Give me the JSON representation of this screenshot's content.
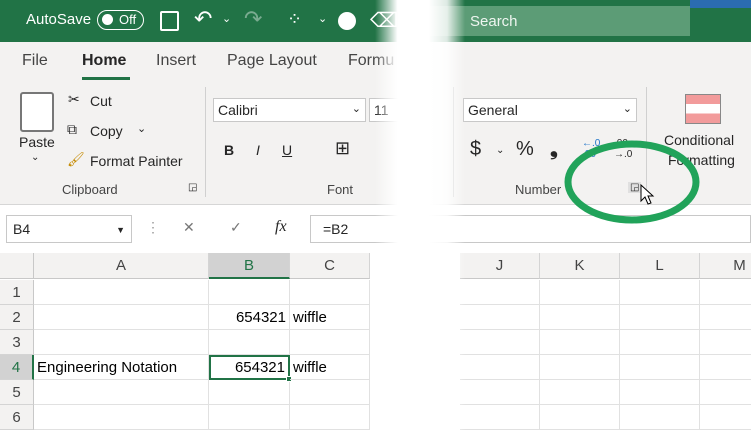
{
  "titlebar": {
    "autosave_label": "AutoSave",
    "toggle_state": "Off",
    "search_placeholder": "Search"
  },
  "tabs": [
    "File",
    "Home",
    "Insert",
    "Page Layout",
    "Formu"
  ],
  "ribbon": {
    "clipboard": {
      "paste": "Paste",
      "cut": "Cut",
      "copy": "Copy",
      "format_painter": "Format Painter",
      "label": "Clipboard"
    },
    "font": {
      "name": "Calibri",
      "size": "11",
      "bold": "B",
      "italic": "I",
      "underline": "U",
      "label": "Font"
    },
    "number": {
      "format": "General",
      "currency": "$",
      "percent": "%",
      "comma": "❟",
      "inc_decimal": "←.0 .00",
      "dec_decimal": ".00 →.0",
      "label": "Number"
    },
    "styles": {
      "conditional": "Conditional",
      "formatting": "Formatting"
    }
  },
  "formula_bar": {
    "name_box": "B4",
    "cancel": "✕",
    "enter": "✓",
    "fx": "fx",
    "formula": "=B2"
  },
  "grid": {
    "columns": [
      "A",
      "B",
      "C",
      "J",
      "K",
      "L",
      "M"
    ],
    "rows": [
      "1",
      "2",
      "3",
      "4",
      "5",
      "6"
    ],
    "cells": {
      "B2": "654321",
      "C2": "wiffle",
      "A4": "Engineering Notation",
      "B4": "654321",
      "C4": "wiffle"
    },
    "selected": "B4"
  },
  "colors": {
    "excel_green": "#217346",
    "highlight": "#21a35a"
  }
}
